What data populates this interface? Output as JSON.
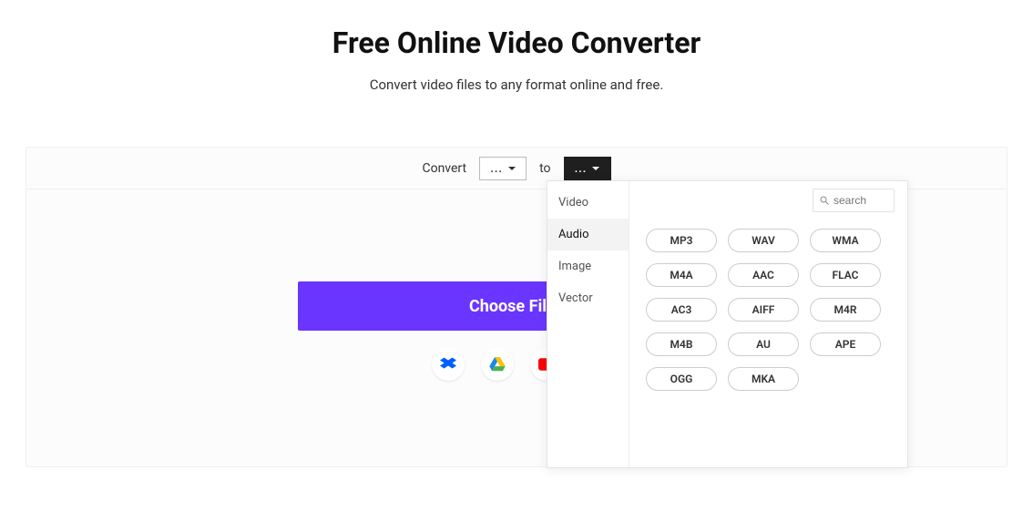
{
  "hero": {
    "title": "Free Online Video Converter",
    "subtitle": "Convert video files to any format online and free."
  },
  "toolbar": {
    "convert_label": "Convert",
    "to_label": "to",
    "from_glyph": "...",
    "to_glyph": "..."
  },
  "choose_label": "Choose Files",
  "dropdown": {
    "categories": [
      "Video",
      "Audio",
      "Image",
      "Vector"
    ],
    "active_index": 1,
    "search_placeholder": "search",
    "formats": [
      "MP3",
      "WAV",
      "WMA",
      "M4A",
      "AAC",
      "FLAC",
      "AC3",
      "AIFF",
      "M4R",
      "M4B",
      "AU",
      "APE",
      "OGG",
      "MKA"
    ]
  },
  "colors": {
    "accent": "#6a35ff"
  }
}
